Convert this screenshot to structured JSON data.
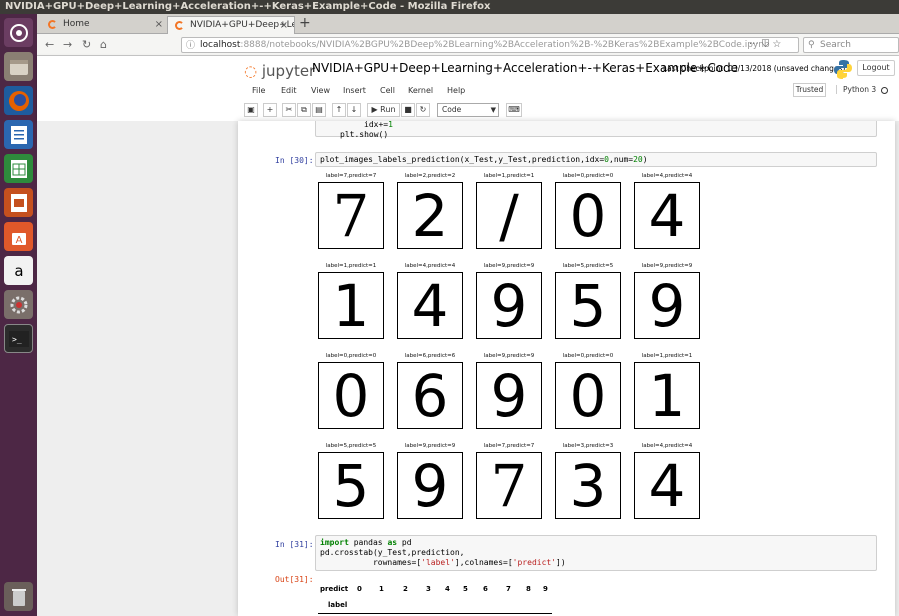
{
  "window": {
    "title": "NVIDIA+GPU+Deep+Learning+Acceleration+-+Keras+Example+Code - Mozilla Firefox"
  },
  "tabs": [
    {
      "label": "Home",
      "close": "×"
    },
    {
      "label": "NVIDIA+GPU+Deep+Lea",
      "close": "×"
    }
  ],
  "newtab": "+",
  "nav": {
    "back": "←",
    "forward": "→",
    "reload": "↻",
    "home": "⌂",
    "url_host": "localhost",
    "url_rest": ":8888/notebooks/NVIDIA%2BGPU%2BDeep%2BLearning%2BAcceleration%2B-%2BKeras%2BExample%2BCode.ipynb",
    "url_icons": "··· ⛉ ☆",
    "search_placeholder": "Search"
  },
  "jupyter": {
    "logo": "jupyter",
    "notebook_title": "NVIDIA+GPU+Deep+Learning+Acceleration+-+Keras+Example+Code",
    "checkpoint": "Last Checkpoint: 03/13/2018  (unsaved changes)",
    "logout": "Logout",
    "trusted": "Trusted",
    "kernel": "Python 3",
    "menu": [
      "File",
      "Edit",
      "View",
      "Insert",
      "Cell",
      "Kernel",
      "Help"
    ],
    "run_label": "Run",
    "cell_type": "Code"
  },
  "cells": {
    "prev_code_line1": "idx+=1",
    "prev_code_line2": "plt.show()",
    "c30_prompt": "In [30]:",
    "c30_code": "plot_images_labels_prediction(x_Test,y_Test,prediction,idx=0,num=20)",
    "c31_prompt": "In [31]:",
    "c31_line2": "pd.crosstab(y_Test,prediction,",
    "out31_prompt": "Out[31]:"
  },
  "digits": [
    {
      "label": "label=7,predict=7",
      "glyph": "7"
    },
    {
      "label": "label=2,predict=2",
      "glyph": "2"
    },
    {
      "label": "label=1,predict=1",
      "glyph": "/"
    },
    {
      "label": "label=0,predict=0",
      "glyph": "0"
    },
    {
      "label": "label=4,predict=4",
      "glyph": "4"
    },
    {
      "label": "label=1,predict=1",
      "glyph": "1"
    },
    {
      "label": "label=4,predict=4",
      "glyph": "4"
    },
    {
      "label": "label=9,predict=9",
      "glyph": "9"
    },
    {
      "label": "label=5,predict=5",
      "glyph": "5"
    },
    {
      "label": "label=9,predict=9",
      "glyph": "9"
    },
    {
      "label": "label=0,predict=0",
      "glyph": "0"
    },
    {
      "label": "label=6,predict=6",
      "glyph": "6"
    },
    {
      "label": "label=9,predict=9",
      "glyph": "9"
    },
    {
      "label": "label=0,predict=0",
      "glyph": "0"
    },
    {
      "label": "label=1,predict=1",
      "glyph": "1"
    },
    {
      "label": "label=5,predict=5",
      "glyph": "5"
    },
    {
      "label": "label=9,predict=9",
      "glyph": "9"
    },
    {
      "label": "label=7,predict=7",
      "glyph": "7"
    },
    {
      "label": "label=3,predict=3",
      "glyph": "3"
    },
    {
      "label": "label=4,predict=4",
      "glyph": "4"
    }
  ],
  "crosstab": {
    "col_header": "predict",
    "columns": [
      "0",
      "1",
      "2",
      "3",
      "4",
      "5",
      "6",
      "7",
      "8",
      "9"
    ],
    "index_header": "label"
  }
}
